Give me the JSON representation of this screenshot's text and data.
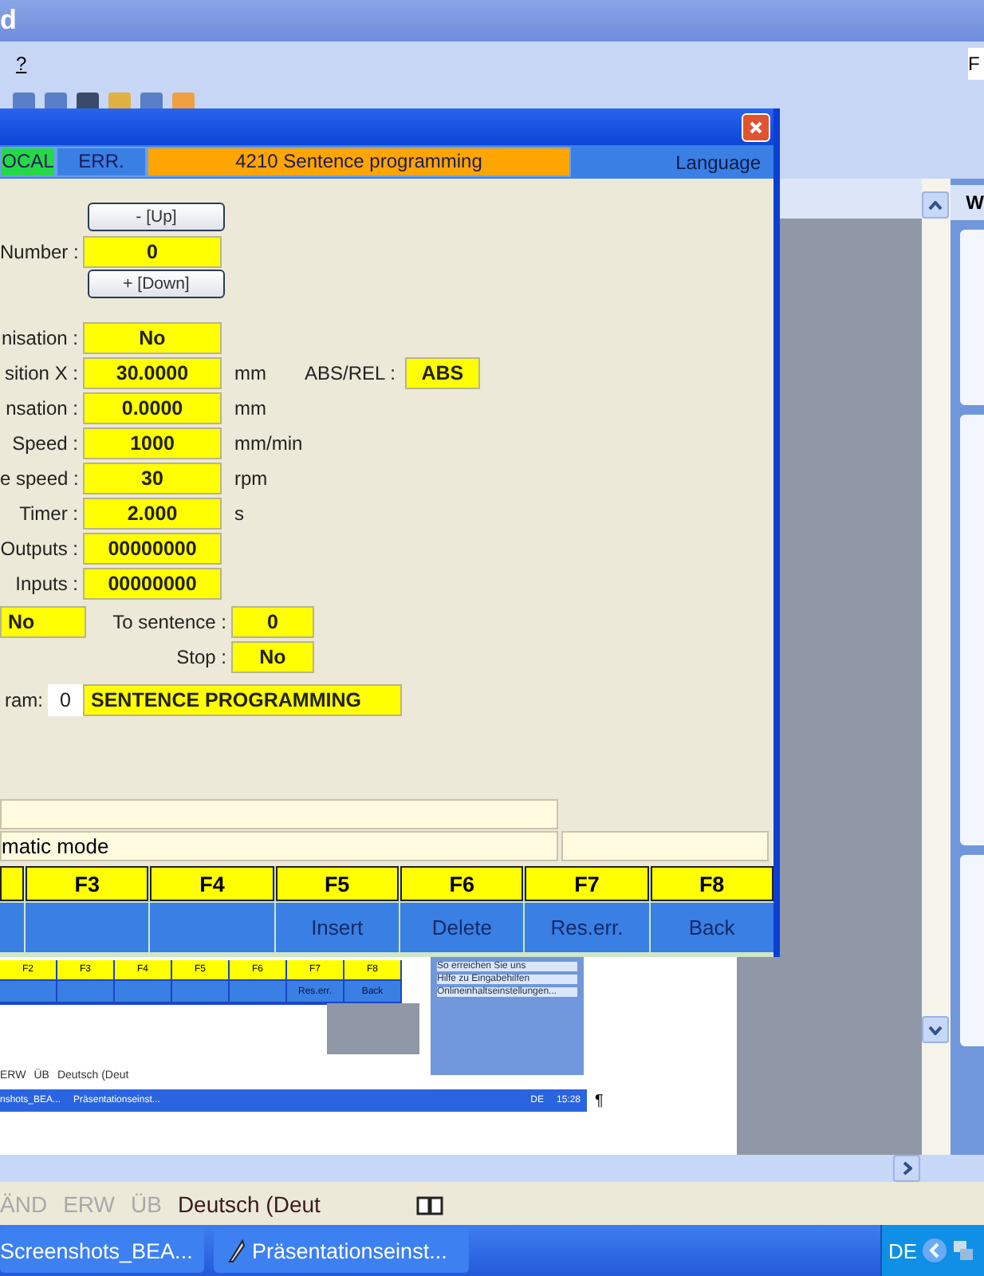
{
  "app": {
    "title": "d",
    "menu": [
      {
        "label": "?"
      }
    ],
    "help_field": {
      "value": "F"
    },
    "task_pane": {
      "title": "W"
    }
  },
  "dialog": {
    "status": [
      {
        "label": "OCAL",
        "kind": "local"
      },
      {
        "label": "ERR.",
        "kind": "error"
      },
      {
        "label": "4210 Sentence programming",
        "kind": "title"
      }
    ],
    "language": "Language",
    "up_button": "- [Up]",
    "down_button": "+ [Down]",
    "number": {
      "label": "Number :",
      "value": "0"
    },
    "fields": [
      {
        "label": "nisation :",
        "value": "No"
      },
      {
        "label": "sition X :",
        "value": "30.0000",
        "unit": "mm"
      },
      {
        "label": "nsation :",
        "value": "0.0000",
        "unit": "mm"
      },
      {
        "label": "Speed :",
        "value": "1000",
        "unit": "mm/min"
      },
      {
        "label": "e speed :",
        "value": "30",
        "unit": "rpm"
      },
      {
        "label": "Timer :",
        "value": "2.000",
        "unit": "s"
      },
      {
        "label": "Outputs :",
        "value": "00000000"
      },
      {
        "label": "Inputs :",
        "value": "00000000"
      }
    ],
    "abs_rel": {
      "label": "ABS/REL :",
      "value": "ABS"
    },
    "jump": {
      "value": "No",
      "to_label": "To sentence :",
      "to_value": "0",
      "stop_label": "Stop :",
      "stop_value": "No"
    },
    "program": {
      "label": "ram:",
      "number": "0",
      "name": "SENTENCE PROGRAMMING"
    },
    "message": "matic mode",
    "fkeys": [
      {
        "key": "F3"
      },
      {
        "key": "F4"
      },
      {
        "key": "F5",
        "action": "Insert"
      },
      {
        "key": "F6",
        "action": "Delete"
      },
      {
        "key": "F7",
        "action": "Res.err."
      },
      {
        "key": "F8",
        "action": "Back"
      }
    ]
  },
  "embedded_screenshot": {
    "fkeys": [
      {
        "key": "F2"
      },
      {
        "key": "F3"
      },
      {
        "key": "F4"
      },
      {
        "key": "F5"
      },
      {
        "key": "F6"
      },
      {
        "key": "F7",
        "action": "Res.err."
      },
      {
        "key": "F8",
        "action": "Back"
      }
    ],
    "help_links": [
      "So erreichen Sie uns",
      "Hilfe zu Eingabehilfen",
      "Onlineinhaltseinstellungen..."
    ],
    "status": [
      "ERW",
      "ÜB",
      "Deutsch (Deut"
    ],
    "taskbar": [
      "nshots_BEA...",
      "Präsentationseinst..."
    ],
    "tray_language": "DE",
    "clock": "15:28"
  },
  "pilcrow": "¶",
  "status_bar": {
    "items": [
      {
        "label": "ÄND",
        "disabled": true
      },
      {
        "label": "ERW",
        "disabled": true
      },
      {
        "label": "ÜB",
        "disabled": true
      },
      {
        "label": "Deutsch (Deut",
        "disabled": false
      }
    ]
  },
  "taskbar": {
    "buttons": [
      {
        "label": "Screenshots_BEA..."
      },
      {
        "label": "Präsentationseinst..."
      }
    ],
    "language": "DE"
  }
}
